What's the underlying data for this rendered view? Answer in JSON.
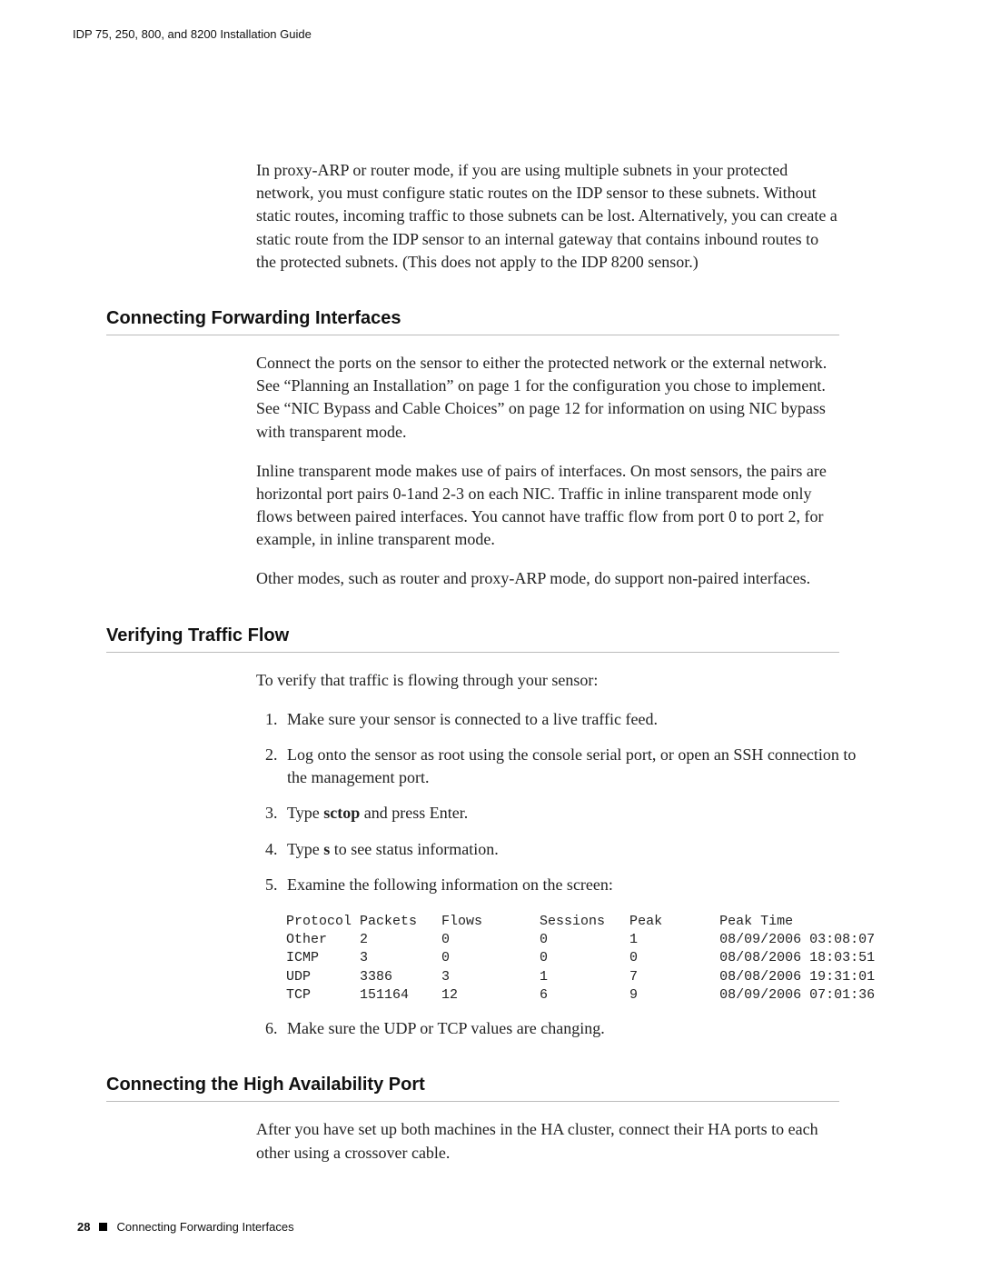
{
  "running_head": "IDP 75, 250, 800, and 8200 Installation Guide",
  "intro_para": "In proxy-ARP or router mode, if you are using multiple subnets in your protected network, you must configure static routes on the IDP sensor to these subnets. Without static routes, incoming traffic to those subnets can be lost. Alternatively, you can create a static route from the IDP sensor to an internal gateway that contains inbound routes to the protected subnets. (This does not apply to the IDP 8200 sensor.)",
  "section1": {
    "heading": "Connecting Forwarding Interfaces",
    "p1": "Connect the ports on the sensor to either the protected network or the external network. See “Planning an Installation” on page 1 for the configuration you chose to implement. See “NIC Bypass and Cable Choices” on page 12 for information on using NIC bypass with transparent mode.",
    "p2": "Inline transparent mode makes use of pairs of interfaces. On most sensors, the pairs are horizontal port pairs 0-1and 2-3 on each NIC. Traffic in inline transparent mode only flows between paired interfaces. You cannot have traffic flow from port 0 to port 2, for example, in inline transparent mode.",
    "p3": "Other modes, such as router and proxy-ARP mode, do support non-paired interfaces."
  },
  "section2": {
    "heading": "Verifying Traffic Flow",
    "intro": "To verify that traffic is flowing through your sensor:",
    "steps": {
      "s1": "Make sure your sensor is connected to a live traffic feed.",
      "s2": "Log onto the sensor as root using the console serial port, or open an SSH connection to the management port.",
      "s3a": "Type ",
      "s3b": "sctop",
      "s3c": " and press Enter.",
      "s4a": "Type ",
      "s4b": "s",
      "s4c": " to see status information.",
      "s5": "Examine the following information on the screen:",
      "s6": "Make sure the UDP or TCP values are changing."
    },
    "table": {
      "header": "Protocol Packets   Flows       Sessions   Peak       Peak Time",
      "rows": [
        "Other    2         0           0          1          08/09/2006 03:08:07",
        "ICMP     3         0           0          0          08/08/2006 18:03:51",
        "UDP      3386      3           1          7          08/08/2006 19:31:01",
        "TCP      151164    12          6          9          08/09/2006 07:01:36"
      ]
    }
  },
  "section3": {
    "heading": "Connecting the High Availability Port",
    "p1": "After you have set up both machines in the HA cluster, connect their HA ports to each other using a crossover cable."
  },
  "footer": {
    "page_number": "28",
    "section_name": "Connecting Forwarding Interfaces"
  },
  "chart_data": {
    "type": "table",
    "title": "Verifying Traffic Flow status output",
    "columns": [
      "Protocol",
      "Packets",
      "Flows",
      "Sessions",
      "Peak",
      "Peak Time"
    ],
    "rows": [
      {
        "Protocol": "Other",
        "Packets": 2,
        "Flows": 0,
        "Sessions": 0,
        "Peak": 1,
        "Peak Time": "08/09/2006 03:08:07"
      },
      {
        "Protocol": "ICMP",
        "Packets": 3,
        "Flows": 0,
        "Sessions": 0,
        "Peak": 0,
        "Peak Time": "08/08/2006 18:03:51"
      },
      {
        "Protocol": "UDP",
        "Packets": 3386,
        "Flows": 3,
        "Sessions": 1,
        "Peak": 7,
        "Peak Time": "08/08/2006 19:31:01"
      },
      {
        "Protocol": "TCP",
        "Packets": 151164,
        "Flows": 12,
        "Sessions": 6,
        "Peak": 9,
        "Peak Time": "08/09/2006 07:01:36"
      }
    ]
  }
}
